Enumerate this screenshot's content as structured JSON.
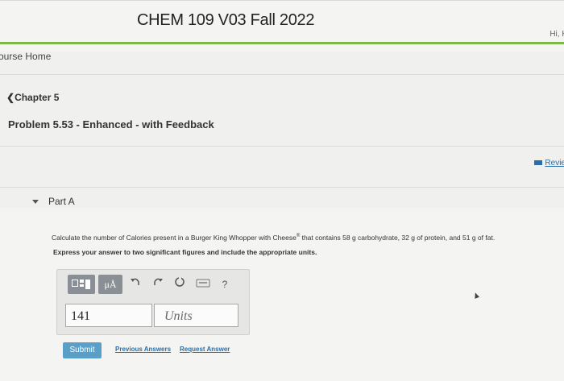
{
  "header": {
    "course_title": "CHEM 109 V03 Fall 2022",
    "greeting": "Hi, K"
  },
  "nav": {
    "course_home": "ourse Home",
    "chapter": "Chapter 5"
  },
  "problem": {
    "title": "Problem 5.53 - Enhanced - with Feedback",
    "review_link": "Revie"
  },
  "part": {
    "label": "Part A",
    "question_text": "Calculate the number of Calories present in a Burger King Whopper with Cheese",
    "question_sup": "®",
    "question_rest": " that contains 58 g carbohydrate, 32 g of protein, and 51 g of fat.",
    "instruction": "Express your answer to two significant figures and include the appropriate units."
  },
  "toolbar": {
    "templates_icon": "templates-icon",
    "mu_label": "μÅ",
    "undo_icon": "undo-icon",
    "redo_icon": "redo-icon",
    "reset_icon": "reset-icon",
    "keyboard_icon": "keyboard-icon",
    "help_label": "?"
  },
  "answer": {
    "value": "141",
    "units_placeholder": "Units"
  },
  "actions": {
    "submit": "Submit",
    "previous_answers": "Previous Answers",
    "request_answer": "Request Answer"
  },
  "colors": {
    "accent_green": "#7db94a",
    "link_blue": "#2a6ea8",
    "submit_blue": "#5a9fc7"
  }
}
